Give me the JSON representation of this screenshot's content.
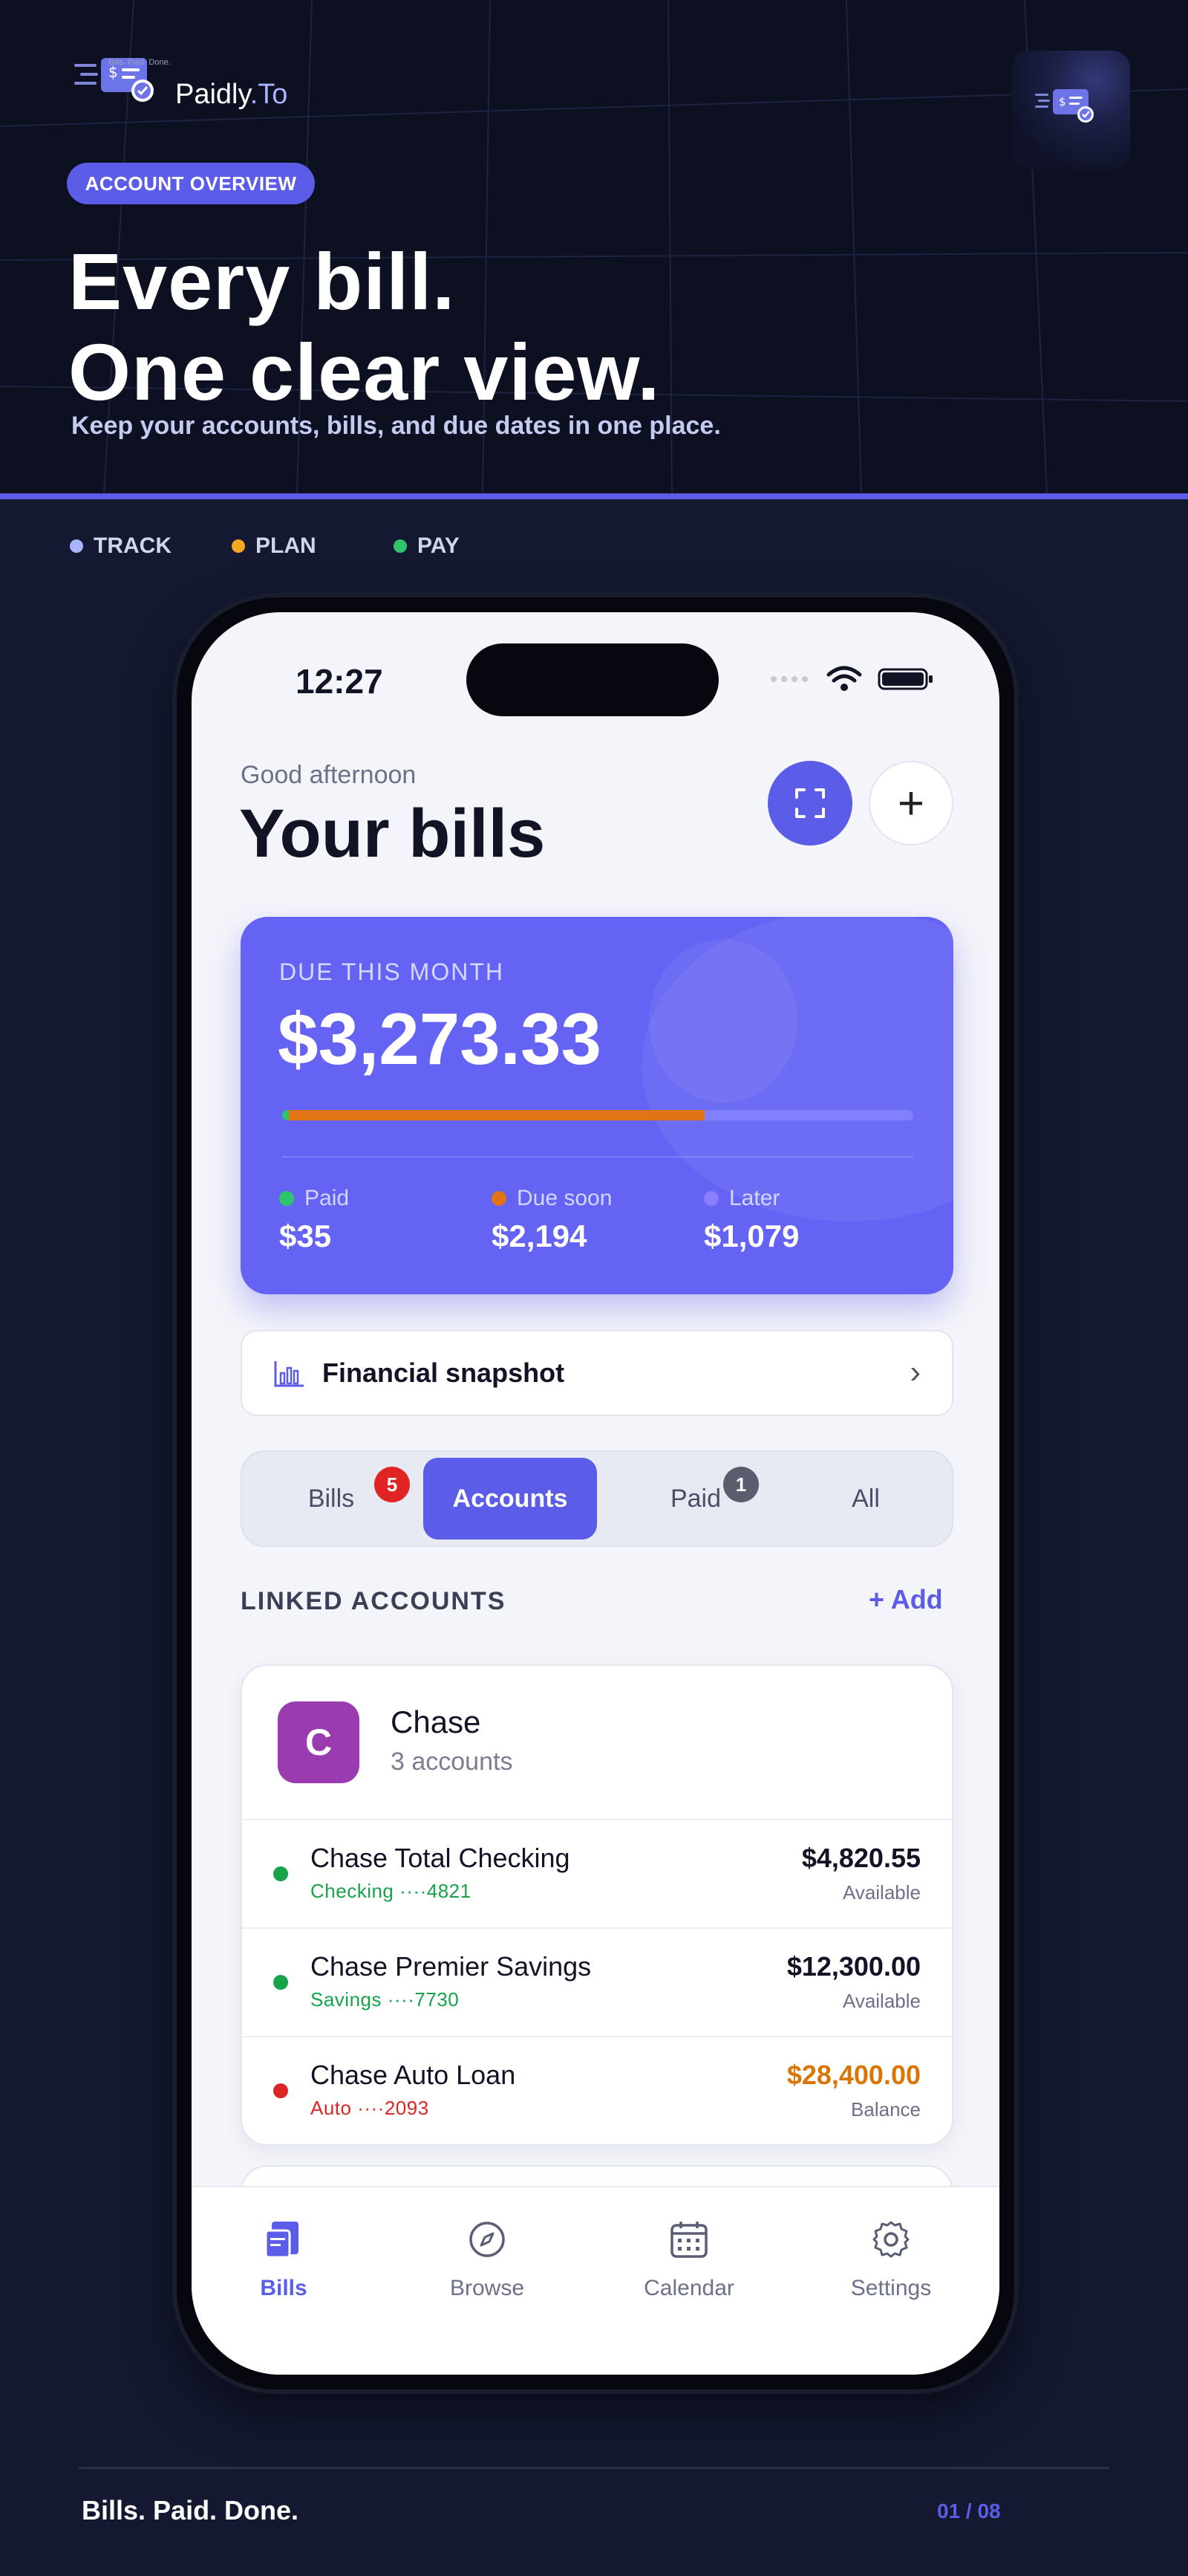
{
  "brand": {
    "name": "Paidly",
    "suffix": ".To",
    "tagline": "Bills. Paid. Done."
  },
  "hero": {
    "pill": "ACCOUNT OVERVIEW",
    "headline_1": "Every bill.",
    "headline_2": "One clear view.",
    "subhead": "Keep your accounts, bills, and due dates in one place."
  },
  "tags": [
    {
      "label": "TRACK",
      "color": "#a8b4ff"
    },
    {
      "label": "PLAN",
      "color": "#f5a623"
    },
    {
      "label": "PAY",
      "color": "#2ec46a"
    }
  ],
  "phone": {
    "status": {
      "time": "12:27"
    },
    "header": {
      "greeting": "Good afternoon",
      "title": "Your bills",
      "add_button": "+"
    },
    "due": {
      "label": "DUE THIS MONTH",
      "amount": "$3,273.33",
      "progress": {
        "paid": 0.011,
        "due_soon": 0.67
      },
      "segments": [
        {
          "label": "Paid",
          "value": "$35",
          "color": "#2ec46a"
        },
        {
          "label": "Due soon",
          "value": "$2,194",
          "color": "#e17414"
        },
        {
          "label": "Later",
          "value": "$1,079",
          "color": "#8a7dff"
        }
      ]
    },
    "snapshot": {
      "label": "Financial snapshot",
      "chevron": "›"
    },
    "tabs": [
      {
        "label": "Bills",
        "badge": "5",
        "active": false
      },
      {
        "label": "Accounts",
        "active": true
      },
      {
        "label": "Paid",
        "badge": "1",
        "active": false
      },
      {
        "label": "All",
        "active": false
      }
    ],
    "linked": {
      "title": "LINKED ACCOUNTS",
      "add_label": "+ Add"
    },
    "account": {
      "initial": "C",
      "name": "Chase",
      "count": "3 accounts",
      "rows": [
        {
          "name": "Chase Total Checking",
          "sub": "Checking ····4821",
          "amount": "$4,820.55",
          "kind": "Available",
          "status_color": "#16a34a",
          "amount_color": "#121425"
        },
        {
          "name": "Chase Premier Savings",
          "sub": "Savings ····7730",
          "amount": "$12,300.00",
          "kind": "Available",
          "status_color": "#16a34a",
          "amount_color": "#121425"
        },
        {
          "name": "Chase Auto Loan",
          "sub": "Auto ····2093",
          "amount": "$28,400.00",
          "kind": "Balance",
          "status_color": "#dc2626",
          "amount_color": "#d97706"
        }
      ]
    },
    "nav": [
      {
        "label": "Bills",
        "icon": "bills-icon",
        "active": true
      },
      {
        "label": "Browse",
        "icon": "compass-icon",
        "active": false
      },
      {
        "label": "Calendar",
        "icon": "calendar-icon",
        "active": false
      },
      {
        "label": "Settings",
        "icon": "gear-icon",
        "active": false
      }
    ]
  },
  "footer": {
    "tagline": "Bills. Paid. Done.",
    "page": "01 / 08"
  },
  "colors": {
    "accent": "#5b5de8",
    "background": "#141931",
    "hero": "#0c1021"
  }
}
